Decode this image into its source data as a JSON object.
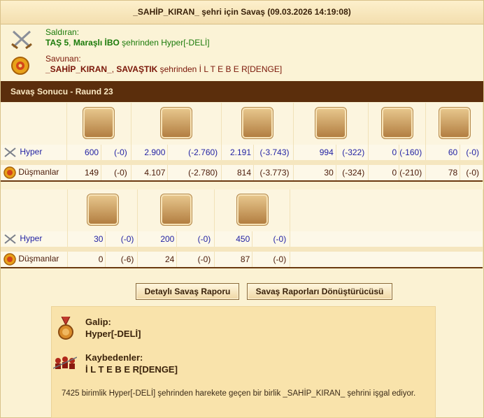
{
  "header": {
    "title": "_SAHİP_KIRAN_ şehri için Savaş (09.03.2026 14:19:08)"
  },
  "attacker": {
    "label": "Saldıran:",
    "name1": "TAŞ 5",
    "sep": ",",
    "name2": "Maraşlı İBO",
    "suffix": " şehrinden Hyper[-DELİ]"
  },
  "defender": {
    "label": "Savunan:",
    "name1": "_SAHİP_KIRAN_",
    "sep": ",",
    "name2": "SAVAŞTIK",
    "suffix": " şehrinden İ L T E B E R[DENGE]"
  },
  "battle_result": {
    "title": "Savaş Sonucu - Raund 23"
  },
  "groups": [
    {
      "units": [
        {
          "icon": "hoplite-unit-icon"
        },
        {
          "icon": "swordsman-unit-icon"
        },
        {
          "icon": "phalanx-unit-icon"
        },
        {
          "icon": "catapult-unit-icon"
        },
        {
          "icon": "steam-giant-unit-icon"
        },
        {
          "icon": "ram-unit-icon"
        }
      ],
      "hyper": {
        "label": "Hyper",
        "values": [
          [
            "600",
            "(-0)"
          ],
          [
            "2.900",
            "(-2.760)"
          ],
          [
            "2.191",
            "(-3.743)"
          ],
          [
            "994",
            "(-322)"
          ],
          [
            "0",
            "(-160)"
          ],
          [
            "60",
            "(-0)"
          ]
        ]
      },
      "enemy": {
        "label": "Düşmanlar",
        "values": [
          [
            "149",
            "(-0)"
          ],
          [
            "4.107",
            "(-2.780)"
          ],
          [
            "814",
            "(-3.773)"
          ],
          [
            "30",
            "(-324)"
          ],
          [
            "0",
            "(-210)"
          ],
          [
            "78",
            "(-0)"
          ]
        ]
      }
    },
    {
      "units": [
        {
          "icon": "mortar-unit-icon"
        },
        {
          "icon": "doctor-unit-icon"
        },
        {
          "icon": "cook-unit-icon"
        }
      ],
      "hyper": {
        "label": "Hyper",
        "values": [
          [
            "30",
            "(-0)"
          ],
          [
            "200",
            "(-0)"
          ],
          [
            "450",
            "(-0)"
          ]
        ]
      },
      "enemy": {
        "label": "Düşmanlar",
        "values": [
          [
            "0",
            "(-6)"
          ],
          [
            "24",
            "(-0)"
          ],
          [
            "87",
            "(-0)"
          ]
        ]
      }
    }
  ],
  "buttons": {
    "detailed": "Detaylı Savaş Raporu",
    "converter": "Savaş Raporları Dönüştürücüsü"
  },
  "result": {
    "winner_label": "Galip:",
    "winner": "Hyper[-DELİ]",
    "loser_label": "Kaybedenler:",
    "loser": "İ L T E B E R[DENGE]",
    "note": "7425 birimlik Hyper[-DELİ] şehrinden harekete geçen bir birlik _SAHİP_KIRAN_ şehrini işgal ediyor."
  },
  "colors": {
    "header_bar": "#5b2e0c",
    "attacker_text": "#1a7a0a",
    "defender_text": "#7a1608",
    "hyper_text": "#2424a4"
  }
}
